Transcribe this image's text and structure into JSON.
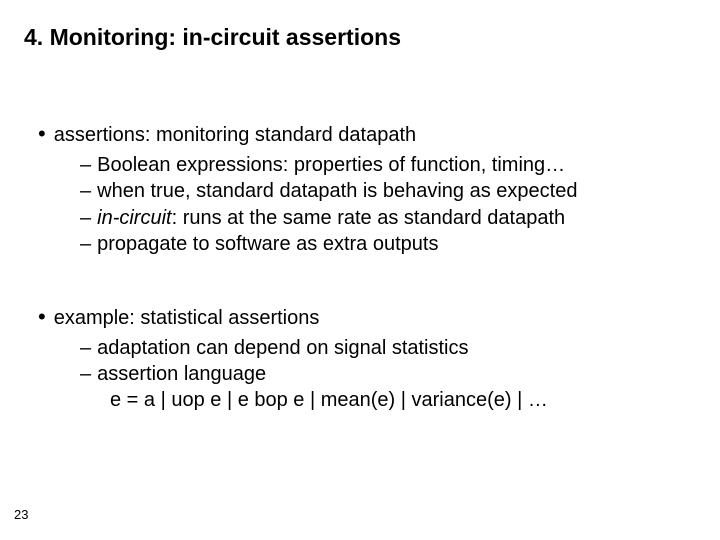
{
  "slide": {
    "title": "4. Monitoring: in-circuit assertions",
    "page_number": "23",
    "blocks": [
      {
        "lead": "assertions: monitoring standard datapath",
        "subs": [
          {
            "text": "Boolean expressions: properties of function, timing…"
          },
          {
            "text": "when true, standard datapath is behaving as expected"
          },
          {
            "italic_lead": "in-circuit",
            "rest": ": runs at the same rate as standard datapath"
          },
          {
            "text": "propagate to software as extra outputs"
          }
        ]
      },
      {
        "lead": "example: statistical assertions",
        "subs": [
          {
            "text": "adaptation can depend on signal statistics"
          },
          {
            "text": "assertion language"
          }
        ],
        "extra_line": "e = a | uop e | e bop e | mean(e) | variance(e) | …"
      }
    ]
  }
}
